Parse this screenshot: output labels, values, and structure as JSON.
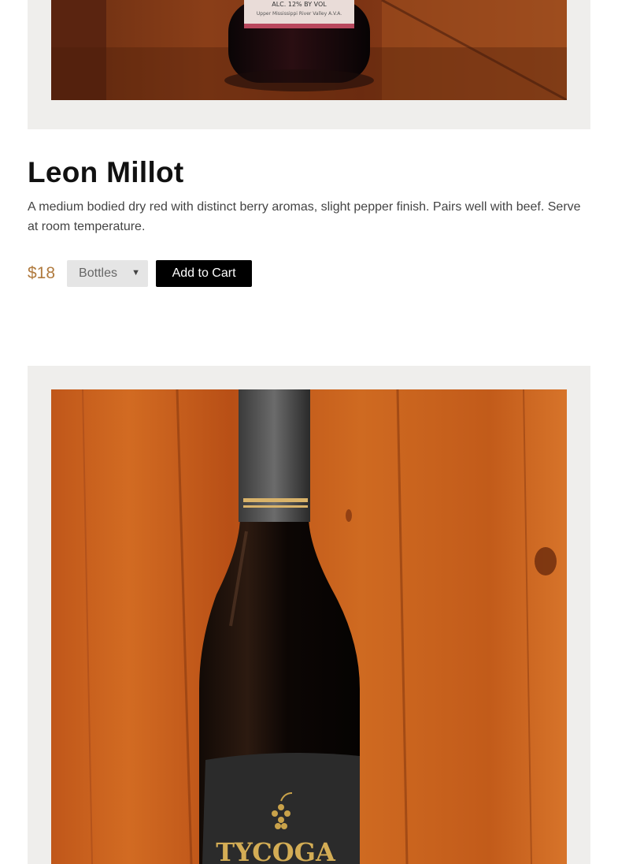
{
  "product": {
    "title": "Leon Millot",
    "description": "A medium bodied dry red with distinct berry aromas, slight pepper finish. Pairs well with beef. Serve at room temperature.",
    "price": "$18",
    "unit_select": {
      "selected": "Bottles"
    },
    "add_to_cart_label": "Add to Cart"
  },
  "top_photo": {
    "label_lines": [
      "ALC. 12% BY VOL",
      "Upper Mississippi River Valley A.V.A."
    ]
  },
  "bottom_photo": {
    "label_text": "TYCOGA"
  },
  "colors": {
    "price": "#b07a3e",
    "frame_background": "#efeeec",
    "button_background": "#000000",
    "select_background": "#e5e5e5",
    "wood": "#c8621c"
  }
}
